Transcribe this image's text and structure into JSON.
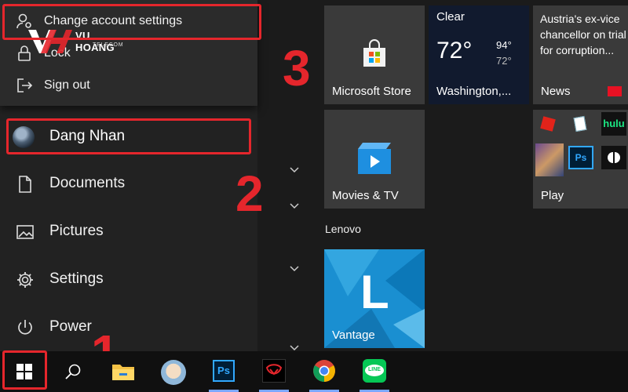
{
  "start_menu": {
    "account_flyout": {
      "change_account_settings": "Change account settings",
      "lock": "Lock",
      "sign_out": "Sign out"
    },
    "watermark": {
      "brand": "VU HOANG",
      "sub": "TELECOM"
    },
    "user_name": "Dang Nhan",
    "nav": {
      "documents": "Documents",
      "pictures": "Pictures",
      "settings": "Settings",
      "power": "Power"
    }
  },
  "step_numbers": {
    "one": "1",
    "two": "2",
    "three": "3"
  },
  "tiles": {
    "store": {
      "label": "Microsoft Store"
    },
    "weather": {
      "condition": "Clear",
      "temp": "72°",
      "high": "94°",
      "low": "72°",
      "location": "Washington,..."
    },
    "news": {
      "headline": "Austria's ex-vice chancellor on trial for corruption...",
      "label": "News"
    },
    "movies": {
      "label": "Movies & TV"
    },
    "play": {
      "label": "Play",
      "hulu_text": "hulu"
    },
    "group_lenovo": "Lenovo",
    "vantage": {
      "label": "Vantage",
      "letter": "L"
    }
  },
  "taskbar": {
    "apps": [
      "start-icon",
      "search-icon",
      "file-explorer-icon",
      "contact-app-icon",
      "photoshop-icon",
      "garena-icon",
      "chrome-icon",
      "line-icon"
    ],
    "ps_text": "Ps",
    "line_text": "LINE"
  },
  "colors": {
    "highlight_red": "#e5262c",
    "start_bg": "#222222",
    "tile_gray": "#3a3a3a",
    "vantage_blue": "#1a8fd1",
    "taskbar": "#101010"
  }
}
